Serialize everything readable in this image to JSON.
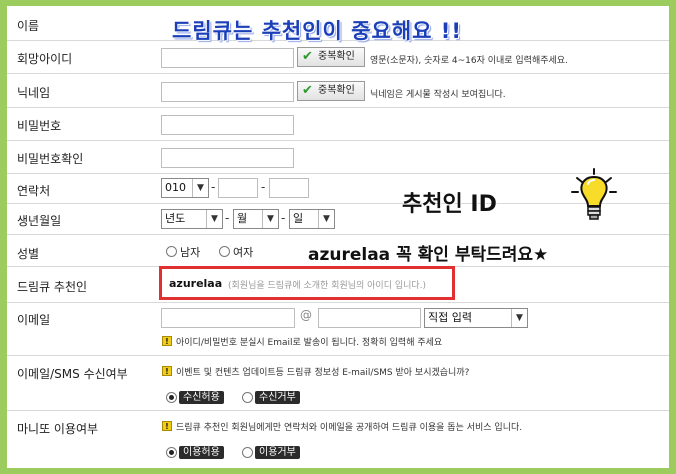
{
  "headline": "드림큐는 추천인이 중요해요 !!",
  "annotation": {
    "title": "추천인 ID",
    "subtitle": "azurelaa 꼭 확인 부탁드려요★"
  },
  "labels": {
    "name": "이름",
    "user_id": "회망아이디",
    "nickname": "닉네임",
    "password": "비밀번호",
    "password_confirm": "비밀번호확인",
    "phone": "연락처",
    "birthday": "생년월일",
    "gender": "성별",
    "recommender": "드림큐 추천인",
    "email": "이메일",
    "email_sms": "이메일/SMS 수신여부",
    "manitto": "마니또 이용여부"
  },
  "buttons": {
    "dup_check_id": "중복확인",
    "dup_check_nick": "중복확인"
  },
  "help": {
    "user_id": "영문(소문자), 숫자로 4~16자 이내로 입력해주세요.",
    "nickname": "닉네임은 게시물 작성시 보여집니다."
  },
  "phone": {
    "prefix": "010",
    "separator": "-"
  },
  "birthday": {
    "year": "년도",
    "month": "월",
    "day": "일",
    "separator": "-"
  },
  "gender": {
    "male": "남자",
    "female": "여자"
  },
  "recommender": {
    "value": "azurelaa",
    "hint": "(회원님을 드림큐에 소개한 회원님의 아이디 입니다.)"
  },
  "email": {
    "at": "@",
    "domain_select": "직접 입력",
    "notice": "아이디/비밀번호 분실시 Email로 발송이 됩니다. 정확히 입력해 주세요"
  },
  "email_sms": {
    "notice": "이벤트 및 컨텐츠 업데이트등 드림큐 정보성 E-mail/SMS 받아 보시겠습니까?",
    "accept": "수신허용",
    "reject": "수신거부"
  },
  "manitto": {
    "notice": "드림큐 추천인 회원님에게만 연락처와 이메일을 공개하여 드림큐 이용을 돕는 서비스 입니다.",
    "accept": "이용허용",
    "reject": "이용거부"
  },
  "icons": {
    "check": "check-icon",
    "warning": "warning-icon",
    "bulb": "light-bulb-icon",
    "dropdown": "chevron-down-icon"
  },
  "colors": {
    "frame": "#9ccc5e",
    "headline": "#1a3fb8",
    "highlight_box": "#e03030"
  }
}
